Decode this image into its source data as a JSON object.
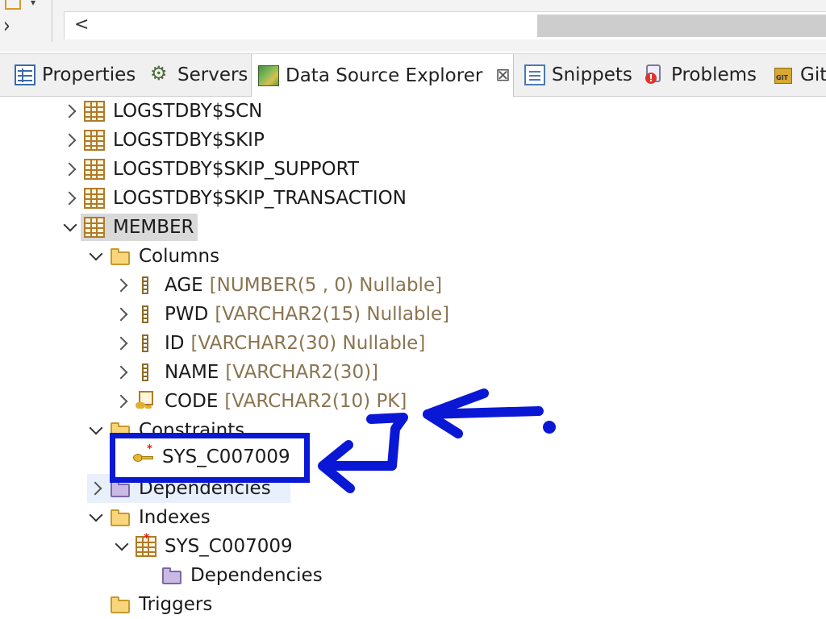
{
  "editor": {
    "scroll_left_glyph": "<"
  },
  "tabs": [
    {
      "label": "Properties",
      "icon": "properties-icon",
      "active": false
    },
    {
      "label": "Servers",
      "icon": "servers-icon",
      "active": false
    },
    {
      "label": "Data Source Explorer",
      "icon": "data-source-explorer-icon",
      "active": true,
      "close": "⊠"
    },
    {
      "label": "Snippets",
      "icon": "snippets-icon",
      "active": false
    },
    {
      "label": "Problems",
      "icon": "problems-icon",
      "active": false
    },
    {
      "label": "Git",
      "icon": "git-icon",
      "active": false
    }
  ],
  "tree": {
    "tables": [
      "LOGSTDBY$SCN",
      "LOGSTDBY$SKIP",
      "LOGSTDBY$SKIP_SUPPORT",
      "LOGSTDBY$SKIP_TRANSACTION"
    ],
    "member": {
      "label": "MEMBER",
      "columns_label": "Columns",
      "columns": [
        {
          "name": "AGE",
          "type": "[NUMBER(5 , 0) Nullable]"
        },
        {
          "name": "PWD",
          "type": "[VARCHAR2(15) Nullable]"
        },
        {
          "name": "ID",
          "type": "[VARCHAR2(30) Nullable]"
        },
        {
          "name": "NAME",
          "type": "[VARCHAR2(30)]"
        },
        {
          "name": "CODE",
          "type": "[VARCHAR2(10) PK]",
          "primary_key": true
        }
      ],
      "constraints_label": "Constraints",
      "constraint": "SYS_C007009",
      "dependencies_label": "Dependencies",
      "indexes_label": "Indexes",
      "index": "SYS_C007009",
      "index_dependencies_label": "Dependencies",
      "triggers_label": "Triggers"
    }
  },
  "colors": {
    "annotation_blue": "#0a18d6",
    "type_text": "#8a7450",
    "selection": "#d9d9d9"
  }
}
